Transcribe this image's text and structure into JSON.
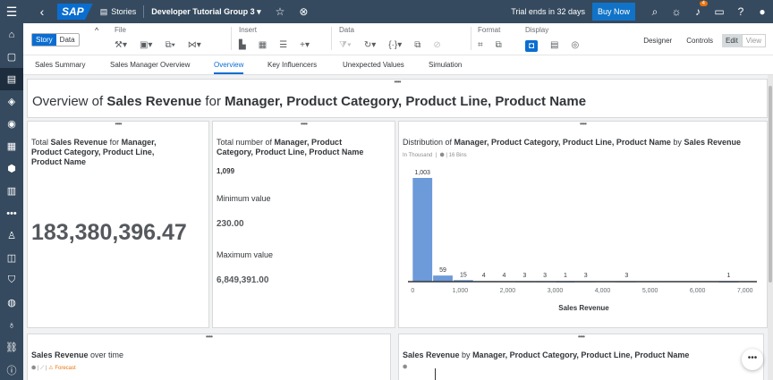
{
  "shell": {
    "logo": "SAP",
    "stories_label": "Stories",
    "story_title": "Developer Tutorial Group 3",
    "trial_text": "Trial ends in 32 days",
    "buy_label": "Buy Now",
    "notification_count": "4"
  },
  "toolbar": {
    "story_label": "Story",
    "data_label": "Data",
    "groups": [
      "File",
      "Insert",
      "Data",
      "Format",
      "Display"
    ],
    "designer_label": "Designer",
    "controls_label": "Controls",
    "edit_label": "Edit",
    "view_label": "View"
  },
  "tabs": [
    "Sales Summary",
    "Sales Manager Overview",
    "Overview",
    "Key Influencers",
    "Unexpected Values",
    "Simulation"
  ],
  "page_title": {
    "prefix": "Overview of ",
    "measure": "Sales Revenue",
    "mid": " for ",
    "dims": "Manager, Product Category, Product Line, Product Name"
  },
  "card1": {
    "prefix": "Total ",
    "measure": "Sales Revenue",
    "mid": " for ",
    "dims": "Manager, Product Category, Product Line, Product Name",
    "value": "183,380,396.47"
  },
  "card2": {
    "prefix": "Total number of ",
    "dims": "Manager, Product Category, Product Line, Product Name",
    "count": "1,099",
    "min_label": "Minimum value",
    "min_value": "230.00",
    "max_label": "Maximum value",
    "max_value": "6,849,391.00"
  },
  "card3": {
    "prefix": "Distribution of ",
    "dims": "Manager, Product Category, Product Line, Product Name",
    "mid": " by ",
    "measure": "Sales Revenue",
    "unit": "In Thousand",
    "bins": "16 Bins"
  },
  "card4": {
    "measure": "Sales Revenue",
    "suffix": " over time",
    "forecast_label": "Forecast"
  },
  "card5": {
    "measure": "Sales Revenue",
    "mid": " by ",
    "dims": "Manager, Product Category, Product Line, Product Name"
  },
  "chart_data": {
    "type": "bar",
    "title": "Distribution of Manager, Product Category, Product Line, Product Name by Sales Revenue",
    "xlabel": "Sales Revenue",
    "ylabel": "",
    "x_ticks": [
      0,
      1000,
      2000,
      3000,
      4000,
      5000,
      6000,
      7000
    ],
    "x_tick_labels": [
      "0",
      "1,000",
      "2,000",
      "3,000",
      "4,000",
      "5,000",
      "6,000",
      "7,000"
    ],
    "xlim": [
      -100,
      7250
    ],
    "bars": [
      {
        "x": 0,
        "value": 1003
      },
      {
        "x": 430,
        "value": 59
      },
      {
        "x": 860,
        "value": 15
      },
      {
        "x": 1290,
        "value": 4
      },
      {
        "x": 1720,
        "value": 4
      },
      {
        "x": 2150,
        "value": 3
      },
      {
        "x": 2580,
        "value": 3
      },
      {
        "x": 3010,
        "value": 1
      },
      {
        "x": 3440,
        "value": 3
      },
      {
        "x": 4300,
        "value": 3
      },
      {
        "x": 6450,
        "value": 1
      }
    ],
    "ylim": [
      0,
      1003
    ],
    "bar_color": "#6d9ad8"
  }
}
